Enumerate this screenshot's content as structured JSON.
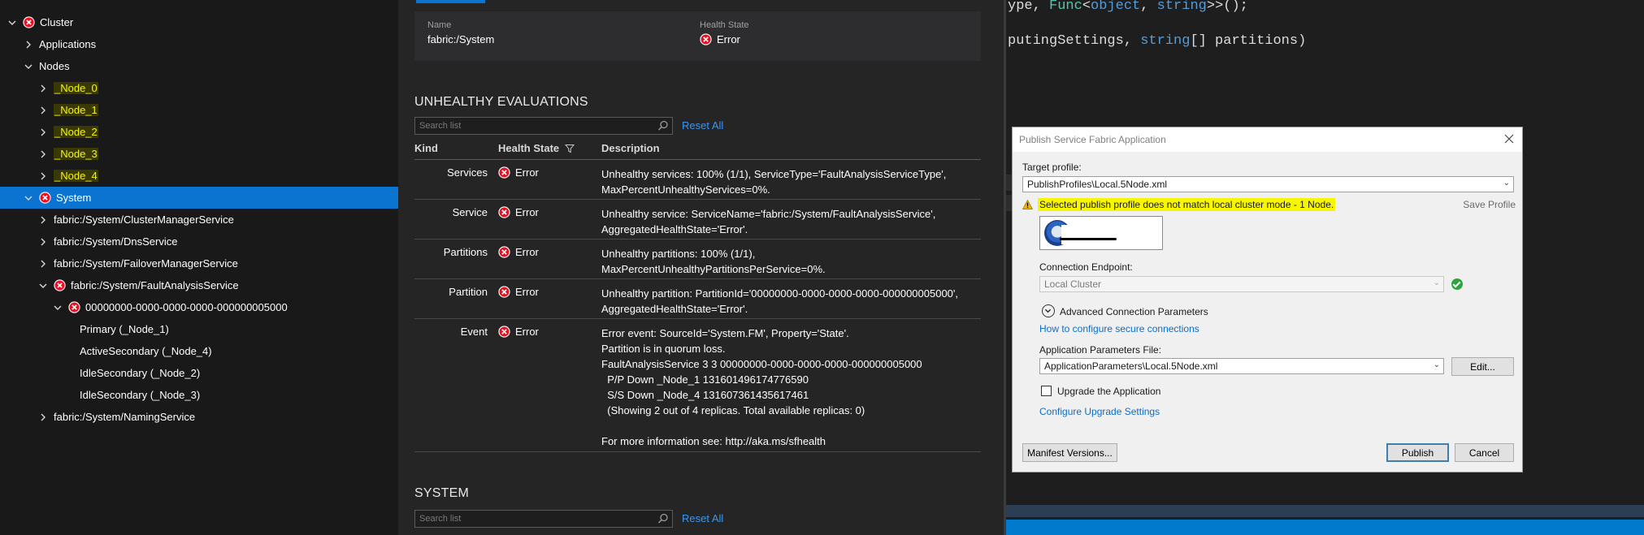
{
  "tree": {
    "items": [
      {
        "label": "Cluster",
        "chevron": "down",
        "error": true,
        "highlight": false,
        "selected": false
      },
      {
        "label": "Applications",
        "chevron": "right",
        "error": false,
        "highlight": false,
        "selected": false
      },
      {
        "label": "Nodes",
        "chevron": "down",
        "error": false,
        "highlight": false,
        "selected": false
      },
      {
        "label": "_Node_0",
        "chevron": "right",
        "error": false,
        "highlight": true,
        "selected": false
      },
      {
        "label": "_Node_1",
        "chevron": "right",
        "error": false,
        "highlight": true,
        "selected": false
      },
      {
        "label": "_Node_2",
        "chevron": "right",
        "error": false,
        "highlight": true,
        "selected": false
      },
      {
        "label": "_Node_3",
        "chevron": "right",
        "error": false,
        "highlight": true,
        "selected": false
      },
      {
        "label": "_Node_4",
        "chevron": "right",
        "error": false,
        "highlight": true,
        "selected": false
      },
      {
        "label": "System",
        "chevron": "down",
        "error": true,
        "highlight": false,
        "selected": true
      },
      {
        "label": "fabric:/System/ClusterManagerService",
        "chevron": "right",
        "error": false,
        "highlight": false,
        "selected": false
      },
      {
        "label": "fabric:/System/DnsService",
        "chevron": "right",
        "error": false,
        "highlight": false,
        "selected": false
      },
      {
        "label": "fabric:/System/FailoverManagerService",
        "chevron": "right",
        "error": false,
        "highlight": false,
        "selected": false
      },
      {
        "label": "fabric:/System/FaultAnalysisService",
        "chevron": "down",
        "error": true,
        "highlight": false,
        "selected": false
      },
      {
        "label": "00000000-0000-0000-0000-000000005000",
        "chevron": "down",
        "error": true,
        "highlight": false,
        "selected": false
      },
      {
        "label": "Primary (_Node_1)",
        "chevron": "none",
        "error": false,
        "highlight": false,
        "selected": false
      },
      {
        "label": "ActiveSecondary (_Node_4)",
        "chevron": "none",
        "error": false,
        "highlight": false,
        "selected": false
      },
      {
        "label": "IdleSecondary (_Node_2)",
        "chevron": "none",
        "error": false,
        "highlight": false,
        "selected": false
      },
      {
        "label": "IdleSecondary (_Node_3)",
        "chevron": "none",
        "error": false,
        "highlight": false,
        "selected": false
      },
      {
        "label": "fabric:/System/NamingService",
        "chevron": "right",
        "error": false,
        "highlight": false,
        "selected": false
      }
    ]
  },
  "essentials": {
    "name_label": "Name",
    "name_value": "fabric:/System",
    "health_label": "Health State",
    "health_value": "Error"
  },
  "unhealthy": {
    "title": "UNHEALTHY EVALUATIONS",
    "search_placeholder": "Search list",
    "reset_label": "Reset All",
    "columns": {
      "kind": "Kind",
      "health": "Health State",
      "description": "Description"
    },
    "rows": [
      {
        "kind": "Services",
        "health": "Error",
        "description": "Unhealthy services: 100% (1/1), ServiceType='FaultAnalysisServiceType',\nMaxPercentUnhealthyServices=0%."
      },
      {
        "kind": "Service",
        "health": "Error",
        "description": "Unhealthy service: ServiceName='fabric:/System/FaultAnalysisService',\nAggregatedHealthState='Error'."
      },
      {
        "kind": "Partitions",
        "health": "Error",
        "description": "Unhealthy partitions: 100% (1/1),\nMaxPercentUnhealthyPartitionsPerService=0%."
      },
      {
        "kind": "Partition",
        "health": "Error",
        "description": "Unhealthy partition: PartitionId='00000000-0000-0000-0000-000000005000',\nAggregatedHealthState='Error'."
      },
      {
        "kind": "Event",
        "health": "Error",
        "description": "Error event: SourceId='System.FM', Property='State'.\nPartition is in quorum loss.\nFaultAnalysisService 3 3 00000000-0000-0000-0000-000000005000\n  P/P Down _Node_1 131601496174776590\n  S/S Down _Node_4 131607361435617461\n  (Showing 2 out of 4 replicas. Total available replicas: 0)\n\nFor more information see: http://aka.ms/sfhealth"
      }
    ]
  },
  "system_section": {
    "title": "SYSTEM",
    "search_placeholder": "Search list",
    "reset_label": "Reset All"
  },
  "code": {
    "line1_a": "ype, ",
    "line1_type": "Func",
    "line1_b": "<",
    "line1_kw1": "object",
    "line1_c": ", ",
    "line1_kw2": "string",
    "line1_d": ">>();",
    "line2_a": "putingSettings, ",
    "line2_kw": "string",
    "line2_b": "[] partitions)"
  },
  "dialog": {
    "title": "Publish Service Fabric Application",
    "target_profile_label": "Target profile:",
    "target_profile_value": "PublishProfiles\\Local.5Node.xml",
    "warning_text": "Selected publish profile does not match local cluster mode - 1 Node.",
    "save_profile": "Save Profile",
    "connection_endpoint_label": "Connection Endpoint:",
    "connection_endpoint_value": "Local Cluster",
    "advanced_label": "Advanced Connection Parameters",
    "secure_link": "How to configure secure connections",
    "app_params_label": "Application Parameters File:",
    "app_params_value": "ApplicationParameters\\Local.5Node.xml",
    "edit_button": "Edit...",
    "upgrade_label": "Upgrade the Application",
    "upgrade_link": "Configure Upgrade Settings",
    "manifest_button": "Manifest Versions...",
    "publish_button": "Publish",
    "cancel_button": "Cancel"
  },
  "colors": {
    "selected": "#0a74d0",
    "error": "#e81123",
    "link": "#3a96f0",
    "warning_highlight": "#f6f600"
  }
}
